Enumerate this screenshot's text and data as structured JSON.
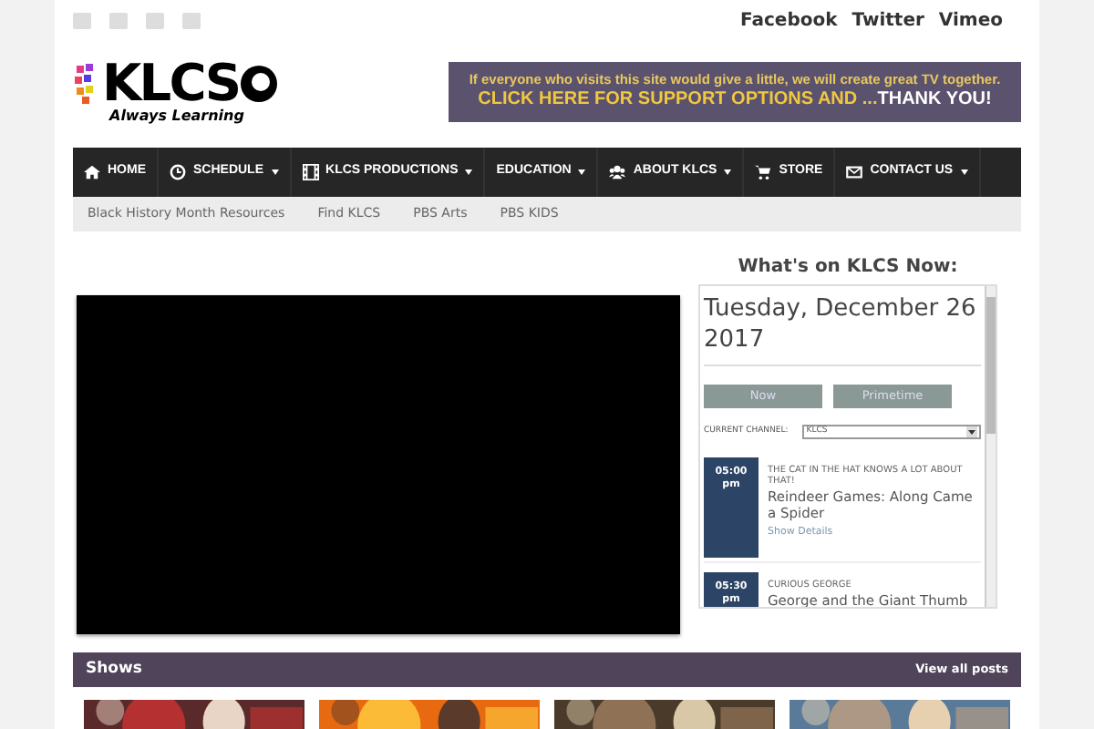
{
  "social_links": [
    "Facebook",
    "Twitter",
    "Vimeo"
  ],
  "logo": {
    "name": "KLCS",
    "tagline": "Always Learning"
  },
  "banner": {
    "line_1": "If everyone who visits this site would give a little, we will create great TV together.",
    "cta": "CLICK HERE FOR SUPPORT OPTIONS AND ...",
    "thanks": "THANK YOU!"
  },
  "nav": [
    {
      "label": "HOME",
      "dropdown": false
    },
    {
      "label": "SCHEDULE",
      "dropdown": true
    },
    {
      "label": "KLCS PRODUCTIONS",
      "dropdown": true
    },
    {
      "label": "EDUCATION",
      "dropdown": true
    },
    {
      "label": "ABOUT KLCS",
      "dropdown": true
    },
    {
      "label": "STORE",
      "dropdown": false
    },
    {
      "label": "CONTACT US",
      "dropdown": true
    }
  ],
  "subnav": [
    "Black History Month Resources",
    "Find KLCS",
    "PBS Arts",
    "PBS KIDS"
  ],
  "schedule": {
    "title": "What's on KLCS Now:",
    "date": "Tuesday, December 26 2017",
    "buttons": [
      "Now",
      "Primetime"
    ],
    "channel_label": "CURRENT CHANNEL:",
    "channel": "KLCS",
    "items": [
      {
        "time": "05:00 pm",
        "series": "THE CAT IN THE HAT KNOWS A LOT ABOUT THAT!",
        "title": "Reindeer Games: Along Came a Spider",
        "details": "Show Details"
      },
      {
        "time": "05:30 pm",
        "series": "CURIOUS GEORGE",
        "title": "George and the Giant Thumb"
      }
    ]
  },
  "shows": {
    "title": "Shows",
    "link": "View all posts"
  }
}
